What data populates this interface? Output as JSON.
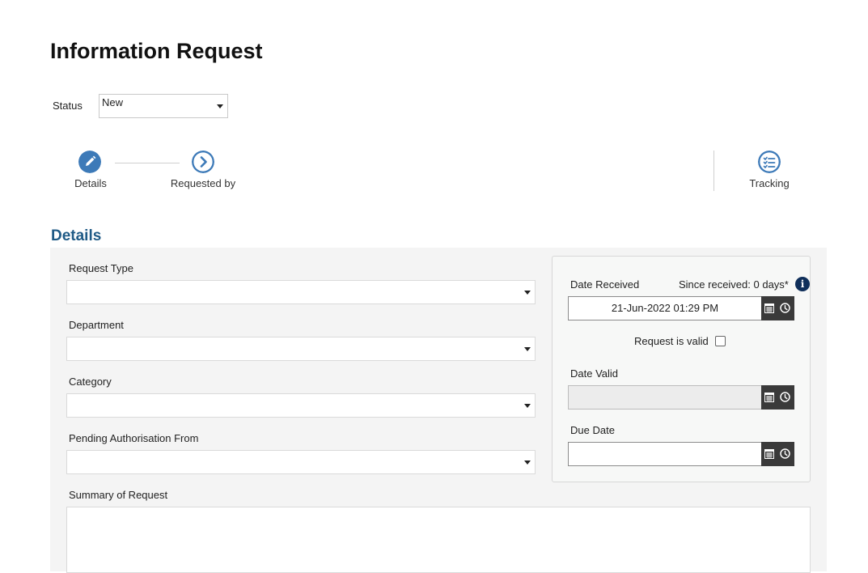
{
  "page": {
    "title": "Information Request"
  },
  "status": {
    "label": "Status",
    "value": "New"
  },
  "steps": [
    {
      "label": "Details",
      "icon": "pencil-icon"
    },
    {
      "label": "Requested by",
      "icon": "chevron-right-icon"
    },
    {
      "label": "Tracking",
      "icon": "checklist-icon"
    }
  ],
  "details": {
    "section_title": "Details",
    "request_type": {
      "label": "Request Type",
      "value": ""
    },
    "department": {
      "label": "Department",
      "value": ""
    },
    "category": {
      "label": "Category",
      "value": ""
    },
    "pending_authorisation": {
      "label": "Pending Authorisation From",
      "value": ""
    },
    "summary": {
      "label": "Summary of Request",
      "value": ""
    },
    "date_received": {
      "label": "Date Received",
      "value": "21-Jun-2022 01:29 PM"
    },
    "since_received": "Since received: 0 days*",
    "request_valid": {
      "label": "Request is valid",
      "checked": false
    },
    "date_valid": {
      "label": "Date Valid",
      "value": ""
    },
    "due_date": {
      "label": "Due Date",
      "value": ""
    }
  },
  "colors": {
    "accent": "#3d7ab8",
    "section_title": "#1f5a86",
    "info_badge": "#0f2f5a",
    "date_buttons": "#3a3a3a"
  }
}
